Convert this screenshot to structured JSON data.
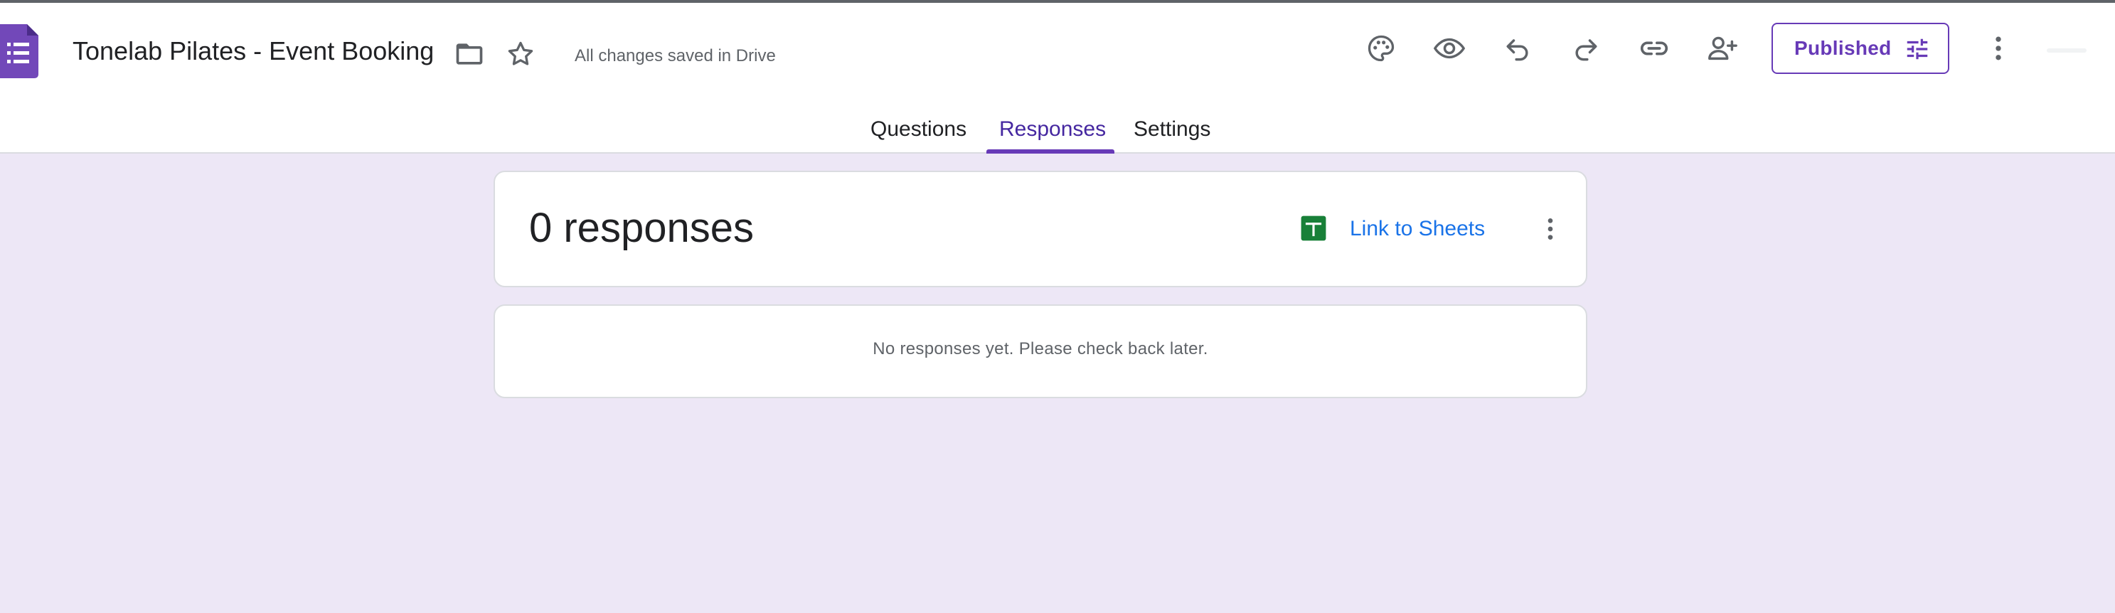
{
  "header": {
    "doc_title": "Tonelab Pilates - Event Booking",
    "save_status": "All changes saved in Drive",
    "published_label": "Published"
  },
  "icons": {
    "logo": "forms-logo-icon",
    "folder": "folder-icon",
    "star": "star-icon",
    "palette": "palette-icon",
    "preview": "eye-icon",
    "undo": "undo-icon",
    "redo": "redo-icon",
    "link": "link-icon",
    "add_collaborator": "person-add-icon",
    "publish_settings": "tune-icon",
    "more": "more-vert-icon",
    "sheets": "sheets-icon"
  },
  "tabs": [
    {
      "label": "Questions",
      "active": false
    },
    {
      "label": "Responses",
      "active": true
    },
    {
      "label": "Settings",
      "active": false
    }
  ],
  "summary": {
    "count_label": "0 responses",
    "link_label": "Link to Sheets"
  },
  "empty_state": {
    "message": "No responses yet. Please check back later."
  },
  "colors": {
    "brand": "#673ab7",
    "background": "#ede7f6",
    "link": "#1a73e8",
    "sheets_green": "#188038"
  }
}
